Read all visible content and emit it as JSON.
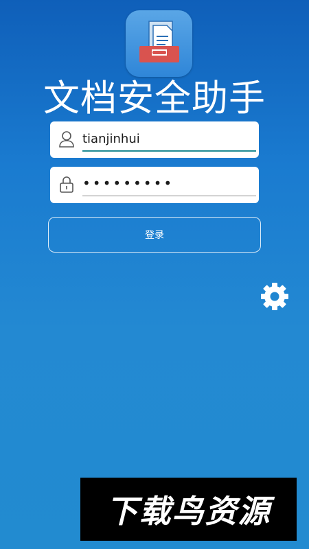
{
  "app": {
    "title": "文档安全助手",
    "logo_icon": "document-tray-icon"
  },
  "login_form": {
    "username": {
      "value": "tianjinhui",
      "icon": "user-icon"
    },
    "password": {
      "masked_value": "•••••••••",
      "icon": "lock-icon"
    },
    "submit_label": "登录"
  },
  "settings": {
    "icon": "gear-icon"
  },
  "watermark": {
    "text": "下载鸟资源"
  },
  "colors": {
    "background_top": "#0f5fb9",
    "background_bottom": "#228bd0",
    "username_underline": "#1f8a93",
    "logo_tray_red": "#d9534f"
  }
}
